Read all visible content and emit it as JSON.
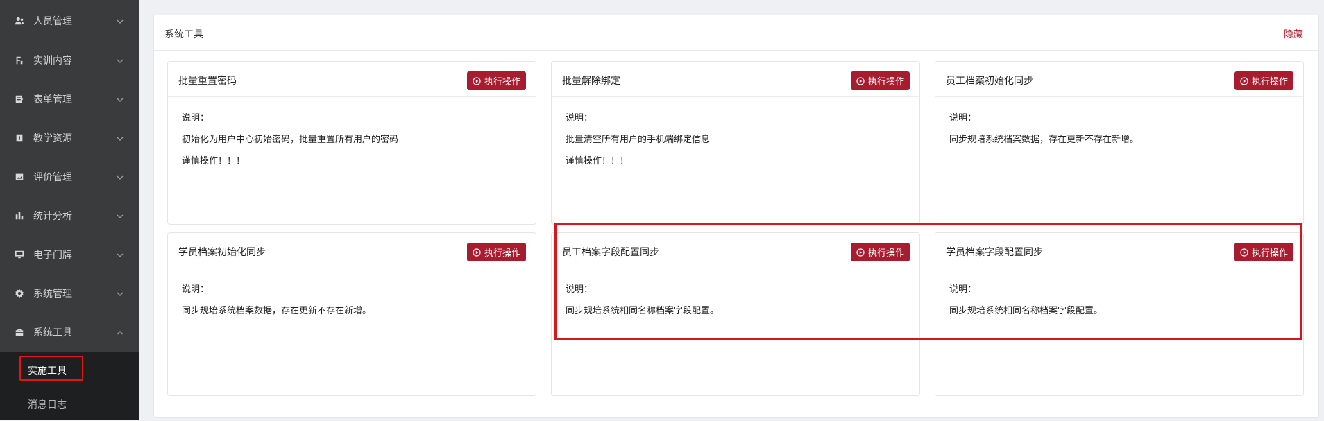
{
  "sidebar": {
    "items": [
      {
        "label": "人员管理",
        "icon": "users-icon"
      },
      {
        "label": "实训内容",
        "icon": "training-icon"
      },
      {
        "label": "表单管理",
        "icon": "form-icon"
      },
      {
        "label": "教学资源",
        "icon": "resource-icon"
      },
      {
        "label": "评价管理",
        "icon": "evaluation-icon"
      },
      {
        "label": "统计分析",
        "icon": "bar-chart-icon"
      },
      {
        "label": "电子门牌",
        "icon": "monitor-icon"
      },
      {
        "label": "系统管理",
        "icon": "gear-icon"
      },
      {
        "label": "系统工具",
        "icon": "toolbox-icon"
      }
    ],
    "submenu": [
      {
        "label": "实施工具",
        "active": true
      },
      {
        "label": "消息日志",
        "active": false
      }
    ]
  },
  "panel": {
    "title": "系统工具",
    "hide_label": "隐藏"
  },
  "button_label": "执行操作",
  "desc_label": "说明：",
  "cards": [
    {
      "title": "批量重置密码",
      "lines": [
        "初始化为用户中心初始密码，批量重置所有用户的密码",
        "谨慎操作！！！"
      ]
    },
    {
      "title": "批量解除绑定",
      "lines": [
        "批量清空所有用户的手机端绑定信息",
        "谨慎操作！！！"
      ]
    },
    {
      "title": "员工档案初始化同步",
      "lines": [
        "同步规培系统档案数据，存在更新不存在新增。"
      ]
    },
    {
      "title": "学员档案初始化同步",
      "lines": [
        "同步规培系统档案数据，存在更新不存在新增。"
      ]
    },
    {
      "title": "员工档案字段配置同步",
      "lines": [
        "同步规培系统相同名称档案字段配置。"
      ]
    },
    {
      "title": "学员档案字段配置同步",
      "lines": [
        "同步规培系统相同名称档案字段配置。"
      ]
    }
  ],
  "colors": {
    "sidebar_bg": "#3a3b3d",
    "submenu_bg": "#1e1f20",
    "primary": "#a81c2f",
    "highlight": "#d7171f"
  }
}
